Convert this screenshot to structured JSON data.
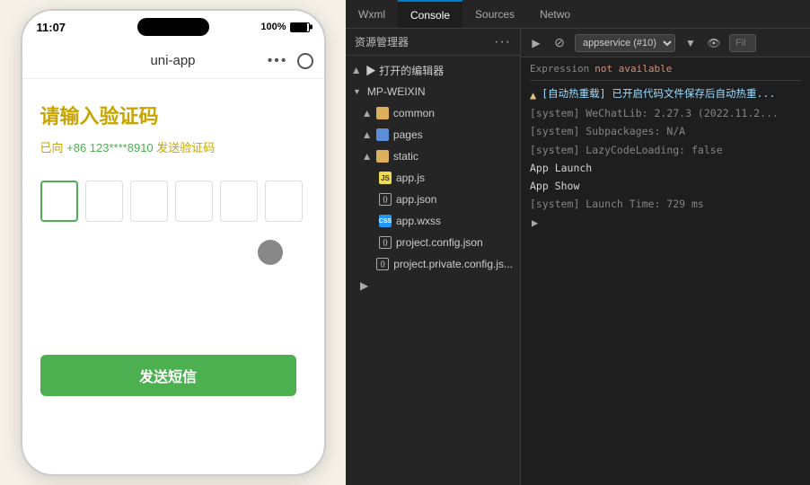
{
  "phone": {
    "time": "11:07",
    "battery_pct": "100%",
    "app_title": "uni-app",
    "verify_title": "请输入验证码",
    "verify_subtitle_prefix": "已向",
    "phone_number": "+86 123****8910",
    "verify_subtitle_suffix": "发送验证码",
    "send_btn_label": "发送短信",
    "code_inputs": [
      "",
      "",
      "",
      "",
      "",
      ""
    ]
  },
  "ide": {
    "tabs": [
      {
        "label": "Wxml",
        "active": false
      },
      {
        "label": "Console",
        "active": true
      },
      {
        "label": "Sources",
        "active": false
      },
      {
        "label": "Netwo",
        "active": false
      }
    ],
    "file_tree": {
      "header": "资源管理器",
      "dots": "···",
      "open_editor_label": "▶ 打开的编辑器",
      "mp_weixin_label": "▼ MP-WEIXIN",
      "items": [
        {
          "indent": 1,
          "arrow": "right",
          "icon": "folder",
          "label": "common"
        },
        {
          "indent": 1,
          "arrow": "right",
          "icon": "folder-blue",
          "label": "pages"
        },
        {
          "indent": 1,
          "arrow": "right",
          "icon": "folder",
          "label": "static"
        },
        {
          "indent": 1,
          "arrow": "none",
          "icon": "js",
          "label": "app.js"
        },
        {
          "indent": 1,
          "arrow": "none",
          "icon": "json",
          "label": "app.json"
        },
        {
          "indent": 1,
          "arrow": "none",
          "icon": "wxss",
          "label": "app.wxss"
        },
        {
          "indent": 1,
          "arrow": "none",
          "icon": "json",
          "label": "project.config.json"
        },
        {
          "indent": 1,
          "arrow": "none",
          "icon": "json",
          "label": "project.private.config.js..."
        }
      ]
    },
    "console": {
      "select_value": "appservice (#10)",
      "filter_placeholder": "Fil",
      "expression_label": "Expression",
      "expression_value": "not available",
      "warning_text": "▲ [自动热重载] 已开启代码文件保存后自动热重...",
      "lines": [
        {
          "type": "gray",
          "text": "[system] WeChatLib: 2.27.3 (2022.11.2..."
        },
        {
          "type": "gray",
          "text": "[system] Subpackages: N/A"
        },
        {
          "type": "gray",
          "text": "[system] LazyCodeLoading: false"
        },
        {
          "type": "normal",
          "text": "App Launch"
        },
        {
          "type": "normal",
          "text": "App Show"
        },
        {
          "type": "gray",
          "text": "[system] Launch Time: 729 ms"
        }
      ],
      "chevron_visible": true
    }
  }
}
